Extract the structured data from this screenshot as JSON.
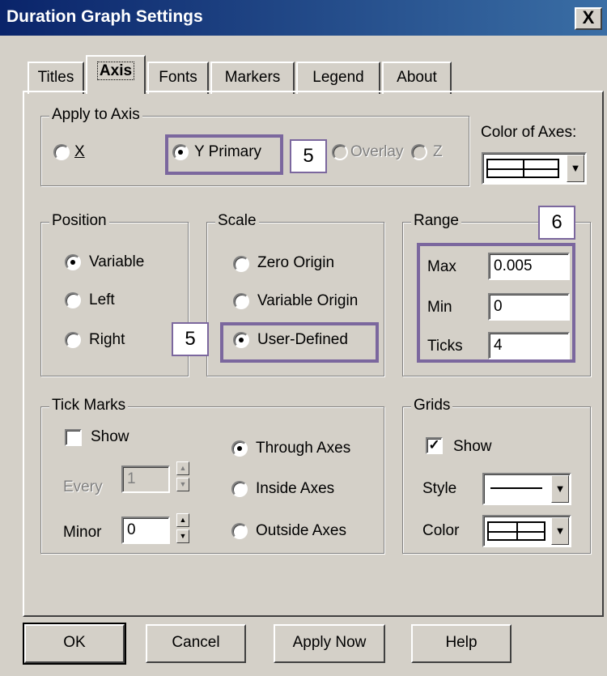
{
  "window": {
    "title": "Duration Graph Settings",
    "close_glyph": "X"
  },
  "tabs": [
    {
      "label": "Titles"
    },
    {
      "label": "Axis"
    },
    {
      "label": "Fonts"
    },
    {
      "label": "Markers"
    },
    {
      "label": "Legend"
    },
    {
      "label": "About"
    }
  ],
  "apply_to_axis": {
    "legend": "Apply to Axis",
    "options": {
      "x": "X",
      "y_primary": "Y Primary",
      "overlay": "Overlay",
      "z": "Z"
    },
    "selected": "Y Primary"
  },
  "color_of_axes": {
    "label": "Color of Axes:",
    "swatch": "grid-icon"
  },
  "position": {
    "legend": "Position",
    "options": {
      "variable": "Variable",
      "left": "Left",
      "right": "Right"
    },
    "selected": "Variable"
  },
  "scale": {
    "legend": "Scale",
    "options": {
      "zero_origin": "Zero Origin",
      "variable_origin": "Variable Origin",
      "user_defined": "User-Defined"
    },
    "selected": "User-Defined"
  },
  "range": {
    "legend": "Range",
    "max_label": "Max",
    "max_value": "0.005",
    "min_label": "Min",
    "min_value": "0",
    "ticks_label": "Ticks",
    "ticks_value": "4"
  },
  "tick_marks": {
    "legend": "Tick Marks",
    "show_label": "Show",
    "show_checked": false,
    "every_label": "Every",
    "every_value": "1",
    "minor_label": "Minor",
    "minor_value": "0",
    "options": {
      "through": "Through Axes",
      "inside": "Inside Axes",
      "outside": "Outside Axes"
    },
    "selected": "Through Axes"
  },
  "grids": {
    "legend": "Grids",
    "show_label": "Show",
    "show_checked": true,
    "style_label": "Style",
    "color_label": "Color"
  },
  "buttons": {
    "ok": "OK",
    "cancel": "Cancel",
    "apply_now": "Apply Now",
    "help": "Help"
  },
  "annotations": {
    "badge_a": "5",
    "badge_b": "5",
    "badge_c": "6"
  },
  "colors": {
    "highlight": "#7b679e",
    "titlebar": "#0a246a",
    "face": "#d4d0c8"
  }
}
